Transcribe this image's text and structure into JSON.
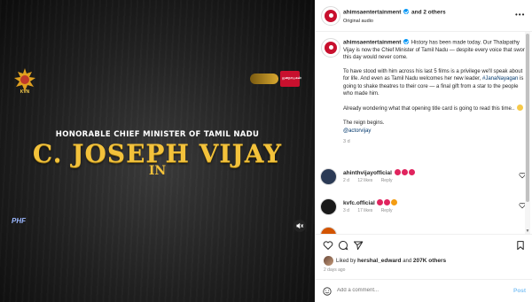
{
  "video": {
    "channel_logo_text": "KVN",
    "badge_text": "ஜனநாயகன்",
    "subtitle": "HONORABLE CHIEF MINISTER OF TAMIL NADU",
    "title": "C. JOSEPH VIJAY",
    "title_suffix": "IN",
    "bottom_logo_text": "PHF",
    "mute_icon": "mute-icon"
  },
  "header": {
    "username": "ahimsaentertainment",
    "and_others": "and 2 others",
    "audio": "Original audio"
  },
  "caption": {
    "username": "ahimsaentertainment",
    "p1": "History has been made today. Our Thalapathy Vijay is now the Chief Minister of Tamil Nadu — despite every voice that swore this day would never come.",
    "p2_a": "To have stood with him across his last 5 films is a privilege we'll speak about for life. And even as Tamil Nadu welcomes her new leader, ",
    "p2_hashtag": "#JanaNayagan",
    "p2_b": " is going to shake theatres to their core — a final gift from a star to the people who made him.",
    "p3": "Already wondering what that opening title card is going to read this time..",
    "p4": "The reign begins.",
    "mention": "@actorvijay",
    "age": "3 d"
  },
  "comments": [
    {
      "username": "ahinthvijayofficial",
      "text": "",
      "age": "2 d",
      "likes": "12 likes",
      "reply": "Reply"
    },
    {
      "username": "kvfc.official",
      "text": "",
      "age": "3 d",
      "likes": "17 likes",
      "reply": "Reply"
    }
  ],
  "actions": {
    "liked_by_prefix": "Liked by",
    "liked_by_user": "hershal_edward",
    "liked_by_and": "and",
    "liked_by_count": "207K others",
    "posted": "2 days ago",
    "comment_placeholder": "Add a comment...",
    "post_label": "Post"
  },
  "colors": {
    "accent": "#0095f6",
    "brand_red": "#c8102e",
    "title_gold": "#f3c23b",
    "link": "#00376b"
  }
}
